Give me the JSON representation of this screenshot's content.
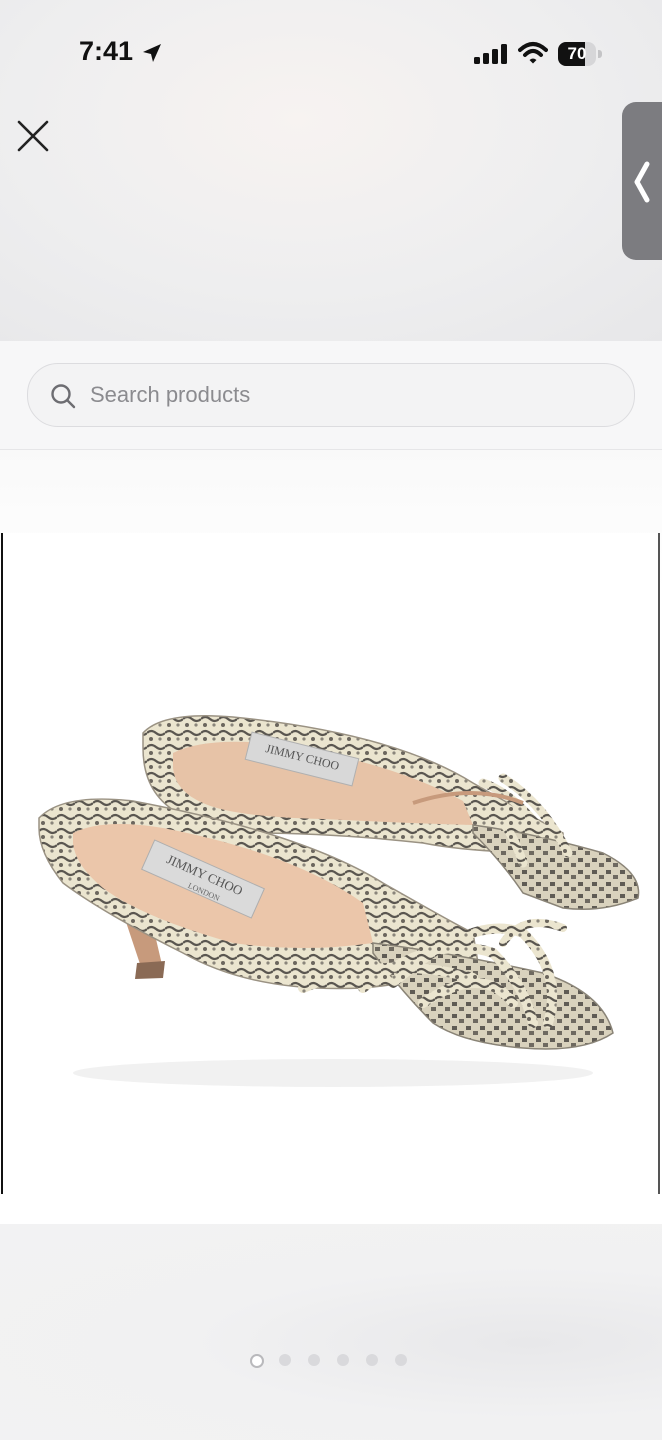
{
  "status_bar": {
    "time": "7:41",
    "battery_level": "70",
    "battery_fraction": 0.7,
    "icons": [
      "location-arrow-icon",
      "cellular-signal-icon",
      "wifi-icon",
      "battery-icon"
    ]
  },
  "header": {
    "close_icon": "close-icon",
    "side_tab_icon": "chevron-left-icon"
  },
  "search": {
    "placeholder": "Search products",
    "value": "",
    "icon": "search-icon"
  },
  "product_image": {
    "brand_label_1": "JIMMY CHOO",
    "brand_label_2": "JIMMY CHOO",
    "brand_sub": "LONDON"
  },
  "carousel": {
    "total": 6,
    "active_index": 0
  },
  "colors": {
    "side_tab": "#7c7c80",
    "insole": "#e8c4a8",
    "snakeskin_light": "#e9e3cc",
    "snakeskin_dark": "#5a5650"
  }
}
